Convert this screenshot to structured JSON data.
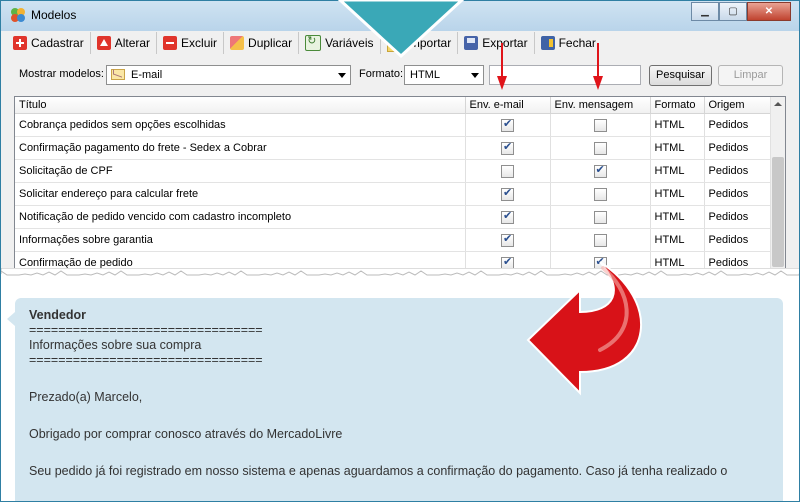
{
  "window": {
    "title": "Modelos"
  },
  "toolbar": {
    "items": [
      {
        "label": "Cadastrar",
        "icon": "add-icon"
      },
      {
        "label": "Alterar",
        "icon": "edit-icon"
      },
      {
        "label": "Excluir",
        "icon": "delete-icon"
      },
      {
        "label": "Duplicar",
        "icon": "duplicate-icon"
      },
      {
        "label": "Variáveis",
        "icon": "variables-icon"
      },
      {
        "label": "Importar",
        "icon": "import-icon"
      },
      {
        "label": "Exportar",
        "icon": "export-icon"
      },
      {
        "label": "Fechar",
        "icon": "close-icon"
      }
    ]
  },
  "filter": {
    "mostrar_label": "Mostrar modelos:",
    "mostrar_value": "E-mail",
    "formato_label": "Formato:",
    "formato_value": "HTML",
    "search_value": "",
    "pesquisar_label": "Pesquisar",
    "limpar_label": "Limpar"
  },
  "grid": {
    "columns": [
      "Título",
      "Env. e-mail",
      "Env. mensagem",
      "Formato",
      "Origem"
    ],
    "rows": [
      {
        "titulo": "Cobrança pedidos sem opções escolhidas",
        "email": true,
        "mensagem": false,
        "formato": "HTML",
        "origem": "Pedidos"
      },
      {
        "titulo": "Confirmação pagamento do frete - Sedex a Cobrar",
        "email": true,
        "mensagem": false,
        "formato": "HTML",
        "origem": "Pedidos"
      },
      {
        "titulo": "Solicitação de CPF",
        "email": false,
        "mensagem": true,
        "formato": "HTML",
        "origem": "Pedidos"
      },
      {
        "titulo": "Solicitar endereço para calcular frete",
        "email": true,
        "mensagem": false,
        "formato": "HTML",
        "origem": "Pedidos"
      },
      {
        "titulo": "Notificação de pedido vencido com cadastro incompleto",
        "email": true,
        "mensagem": false,
        "formato": "HTML",
        "origem": "Pedidos"
      },
      {
        "titulo": "Informações sobre garantia",
        "email": true,
        "mensagem": false,
        "formato": "HTML",
        "origem": "Pedidos"
      },
      {
        "titulo": "Confirmação de pedido",
        "email": true,
        "mensagem": true,
        "formato": "HTML",
        "origem": "Pedidos"
      }
    ]
  },
  "preview": {
    "sender": "Vendedor",
    "lines": [
      "================================",
      "Informações sobre sua compra",
      "================================",
      "",
      "Prezado(a) Marcelo,",
      "",
      "Obrigado por comprar conosco através do MercadoLivre",
      "",
      "Seu pedido já foi registrado em nosso sistema e apenas aguardamos a confirmação do pagamento. Caso já tenha realizado o"
    ]
  },
  "colors": {
    "arrow": "#e0141a",
    "bubble": "#d3e6f0",
    "pointer": "#3aa8b7"
  }
}
